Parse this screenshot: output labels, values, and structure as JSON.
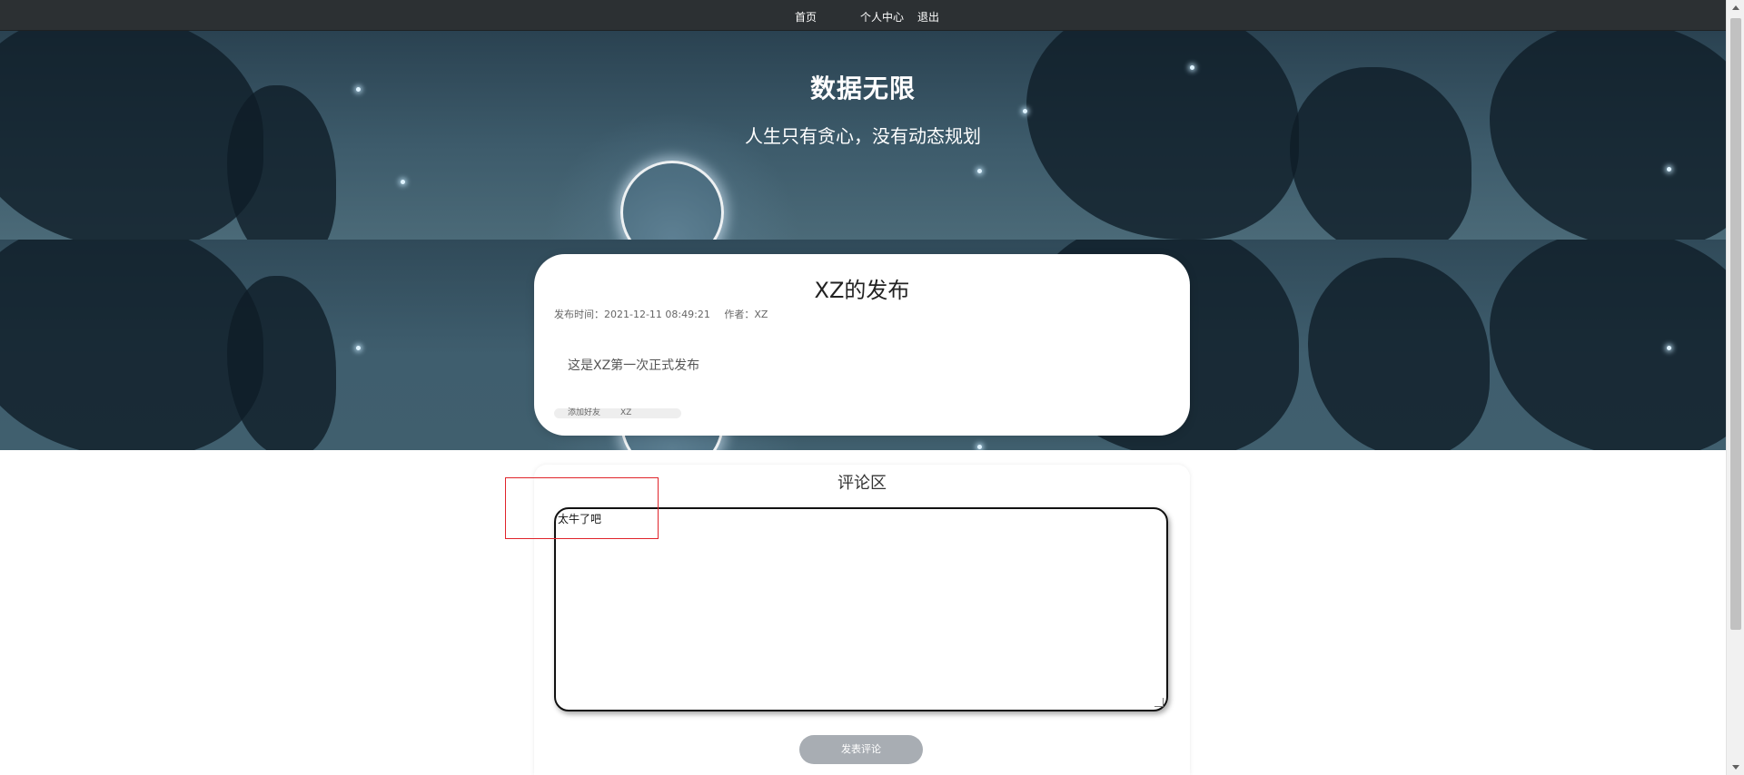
{
  "nav": {
    "home": "首页",
    "profile": "个人中心",
    "logout": "退出"
  },
  "hero": {
    "title": "数据无限",
    "subtitle": "人生只有贪心，没有动态规划"
  },
  "post": {
    "title": "XZ的发布",
    "time_label": "发布时间：2021-12-11 08:49:21",
    "author_label": "作者：XZ",
    "body": "这是XZ第一次正式发布",
    "add_friend": "添加好友",
    "friend_name": "XZ"
  },
  "comments": {
    "title": "评论区",
    "input_value": "太牛了吧",
    "submit": "发表评论"
  },
  "colors": {
    "navbar": "#2c3033",
    "submit_button": "#a8adb3",
    "focus_box": "#e0242b"
  }
}
